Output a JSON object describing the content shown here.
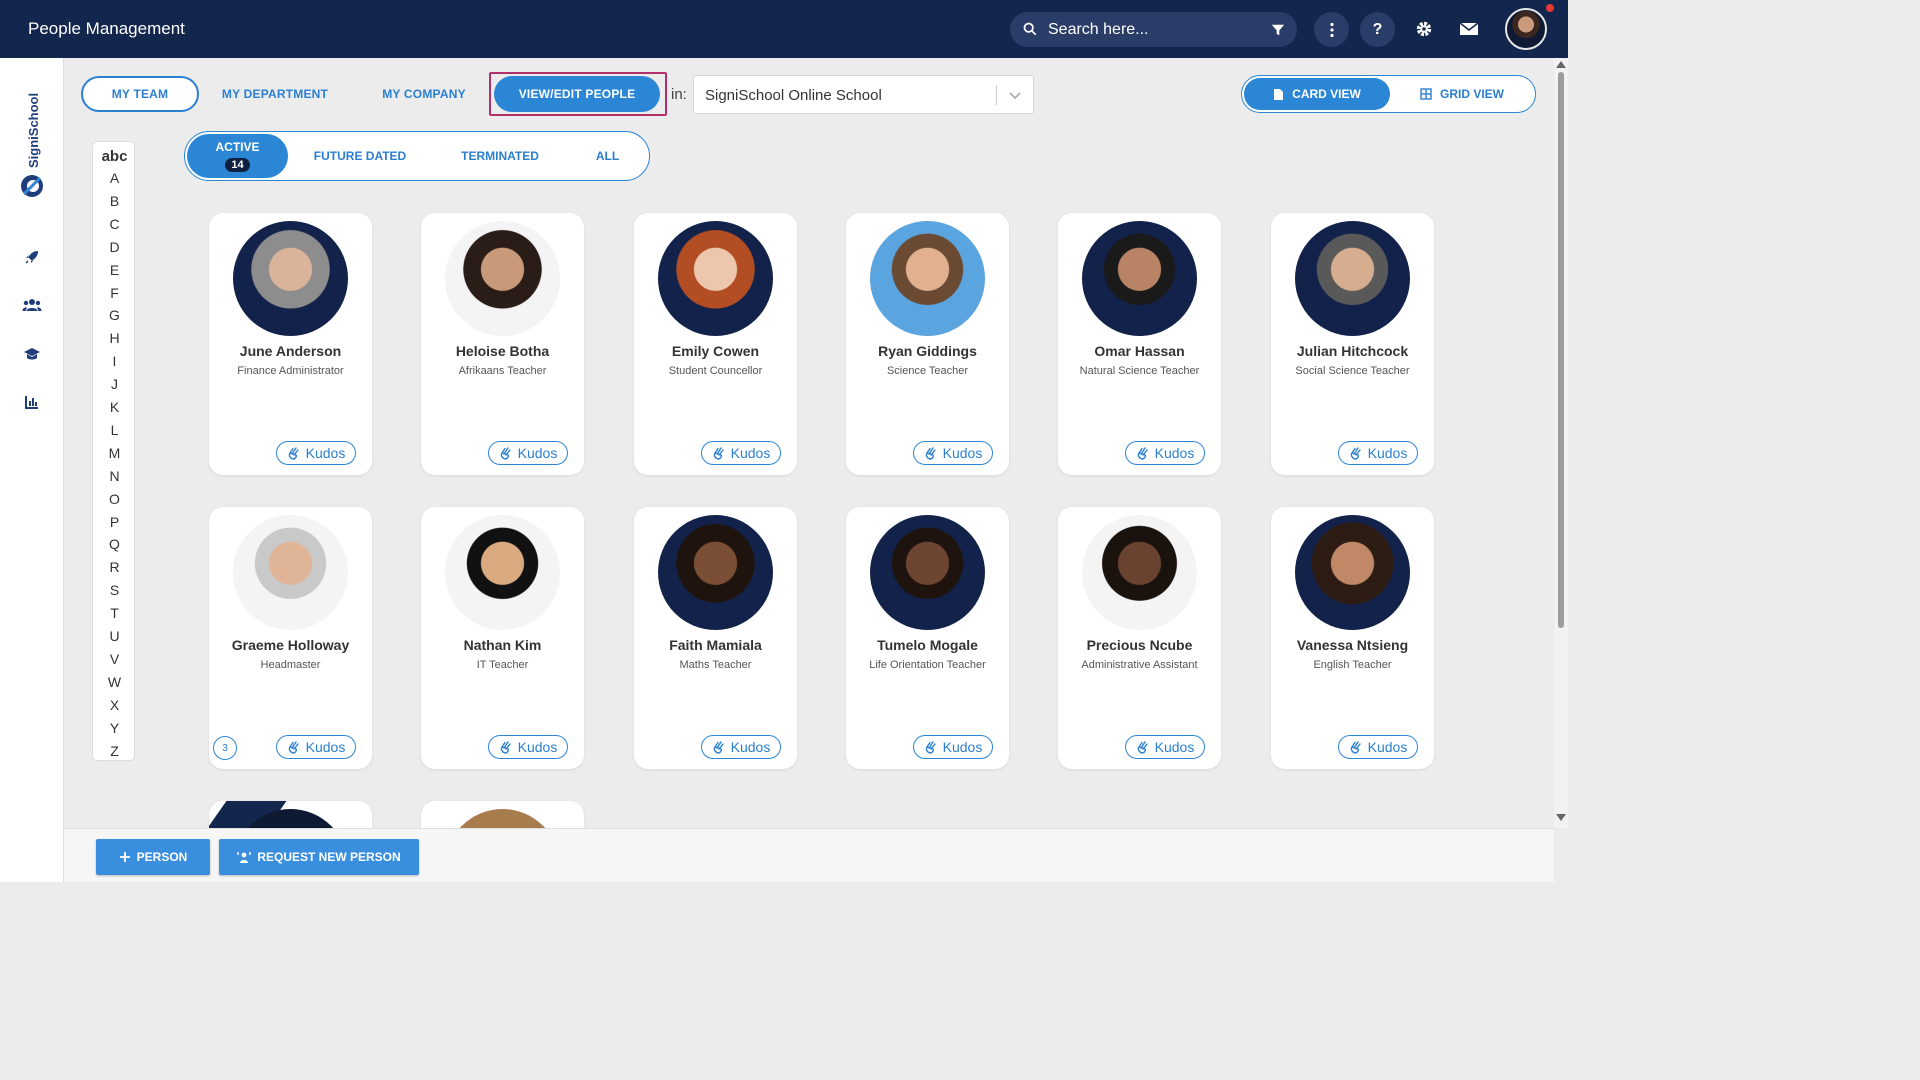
{
  "app": {
    "title": "People Management"
  },
  "search": {
    "placeholder": "Search here..."
  },
  "tabs": [
    {
      "label": "MY TEAM"
    },
    {
      "label": "MY DEPARTMENT"
    },
    {
      "label": "MY COMPANY"
    },
    {
      "label": "VIEW/EDIT PEOPLE"
    }
  ],
  "filter": {
    "in_label": "in:",
    "school": "SigniSchool Online School"
  },
  "views": {
    "card": "CARD VIEW",
    "grid": "GRID VIEW"
  },
  "status_tabs": {
    "active": "ACTIVE",
    "active_count": "14",
    "future": "FUTURE DATED",
    "terminated": "TERMINATED",
    "all": "ALL"
  },
  "alphabet": {
    "abc": "abc",
    "letters": [
      "A",
      "B",
      "C",
      "D",
      "E",
      "F",
      "G",
      "H",
      "I",
      "J",
      "K",
      "L",
      "M",
      "N",
      "O",
      "P",
      "Q",
      "R",
      "S",
      "T",
      "U",
      "V",
      "W",
      "X",
      "Y",
      "Z"
    ]
  },
  "people": [
    {
      "name": "June Anderson",
      "role": "Finance Administrator",
      "kudos": "Kudos"
    },
    {
      "name": "Heloise Botha",
      "role": "Afrikaans Teacher",
      "kudos": "Kudos"
    },
    {
      "name": "Emily Cowen",
      "role": "Student Councellor",
      "kudos": "Kudos"
    },
    {
      "name": "Ryan Giddings",
      "role": "Science Teacher",
      "kudos": "Kudos"
    },
    {
      "name": "Omar Hassan",
      "role": "Natural Science Teacher",
      "kudos": "Kudos"
    },
    {
      "name": "Julian Hitchcock",
      "role": "Social Science Teacher",
      "kudos": "Kudos"
    },
    {
      "name": "Graeme Holloway",
      "role": "Headmaster",
      "kudos": "Kudos",
      "count": "3"
    },
    {
      "name": "Nathan Kim",
      "role": "IT Teacher",
      "kudos": "Kudos"
    },
    {
      "name": "Faith Mamiala",
      "role": "Maths Teacher",
      "kudos": "Kudos"
    },
    {
      "name": "Tumelo Mogale",
      "role": "Life Orientation Teacher",
      "kudos": "Kudos"
    },
    {
      "name": "Precious Ncube",
      "role": "Administrative Assistant",
      "kudos": "Kudos"
    },
    {
      "name": "Vanessa Ntsieng",
      "role": "English Teacher",
      "kudos": "Kudos"
    }
  ],
  "bottom": {
    "add_person": "PERSON",
    "request_person": "REQUEST NEW PERSON"
  },
  "colors": {
    "topbar": "#13264d",
    "accent": "#2b86d6",
    "highlight": "#b0306a"
  },
  "icons": [
    "search-icon",
    "filter-icon",
    "more-vert-icon",
    "help-icon",
    "gear-icon",
    "mail-icon",
    "rocket-icon",
    "people-icon",
    "graduation-cap-icon",
    "bar-chart-icon",
    "document-icon",
    "grid-icon",
    "clap-icon",
    "plus-icon",
    "person-request-icon"
  ]
}
